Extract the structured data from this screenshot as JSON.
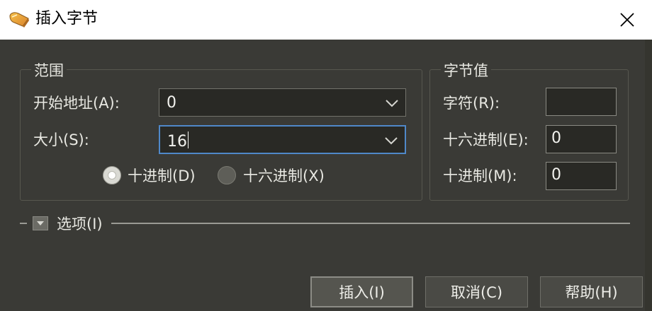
{
  "window": {
    "title": "插入字节"
  },
  "range_group": {
    "title": "范围",
    "start_address_label": "开始地址(A):",
    "start_address_value": "0",
    "size_label": "大小(S):",
    "size_value": "16",
    "radio_decimal_label": "十进制(D)",
    "radio_hex_label": "十六进制(X)",
    "radio_selected": "decimal"
  },
  "byte_value_group": {
    "title": "字节值",
    "char_label": "字符(R):",
    "char_value": "",
    "hex_label": "十六进制(E):",
    "hex_value": "0",
    "dec_label": "十进制(M):",
    "dec_value": "0"
  },
  "options": {
    "label": "选项(I)"
  },
  "buttons": {
    "insert": "插入(I)",
    "cancel": "取消(C)",
    "help": "帮助(H)"
  },
  "icons": {
    "app": "hex-editor-icon",
    "close": "close-icon",
    "dropdown": "chevron-down-icon",
    "expander": "collapse-arrow-icon"
  },
  "colors": {
    "background": "#3a3a36",
    "titlebar": "#ffffff",
    "focus_border": "#4f88c9"
  }
}
